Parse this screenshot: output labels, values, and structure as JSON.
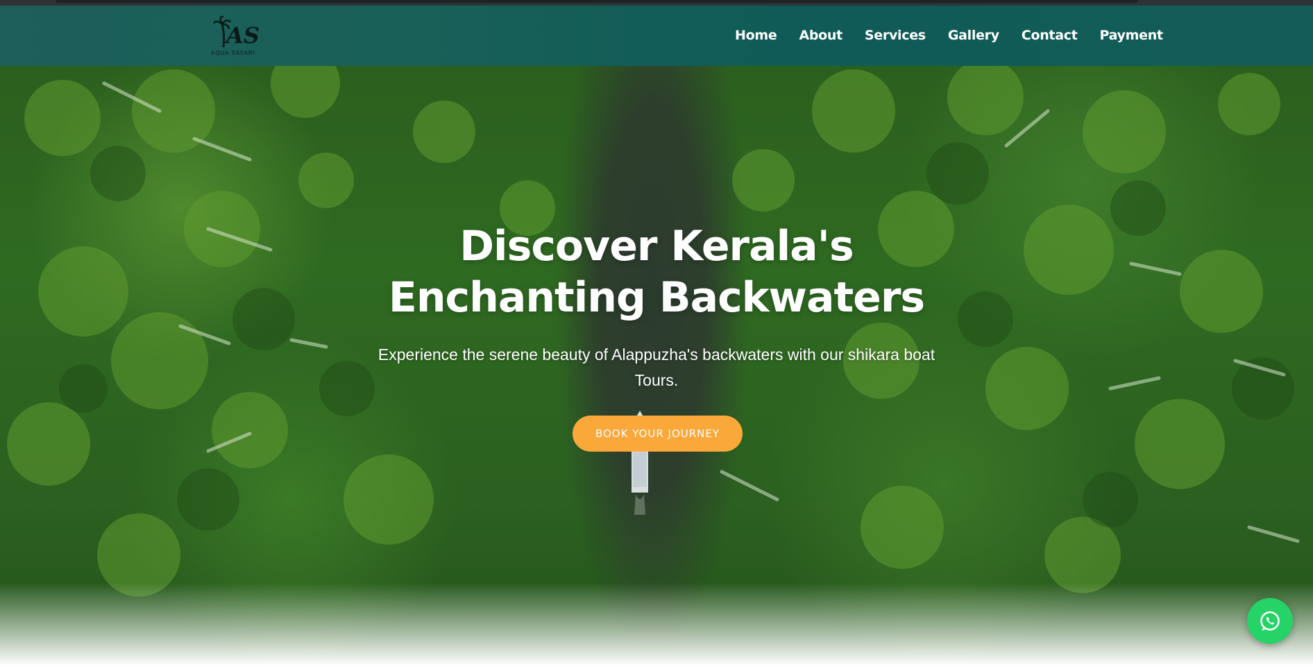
{
  "brand": {
    "logo_text": "AS",
    "logo_caption": "AQUA SAFARI",
    "icon": "palm-tree-icon"
  },
  "nav": {
    "items": [
      {
        "label": "Home"
      },
      {
        "label": "About"
      },
      {
        "label": "Services"
      },
      {
        "label": "Gallery"
      },
      {
        "label": "Contact"
      },
      {
        "label": "Payment"
      }
    ]
  },
  "hero": {
    "title_line1": "Discover Kerala's",
    "title_line2": "Enchanting Backwaters",
    "subtitle": "Experience the serene beauty of Alappuzha's backwaters with our shikara boat Tours.",
    "cta_label": "BOOK YOUR JOURNEY",
    "background": "aerial view of a boat on a backwater canal through palm forest"
  },
  "floating": {
    "whatsapp_icon": "whatsapp-icon"
  },
  "colors": {
    "navbar": "#165e58",
    "cta": "#fba83a",
    "whatsapp": "#25d366",
    "text": "#ffffff"
  }
}
